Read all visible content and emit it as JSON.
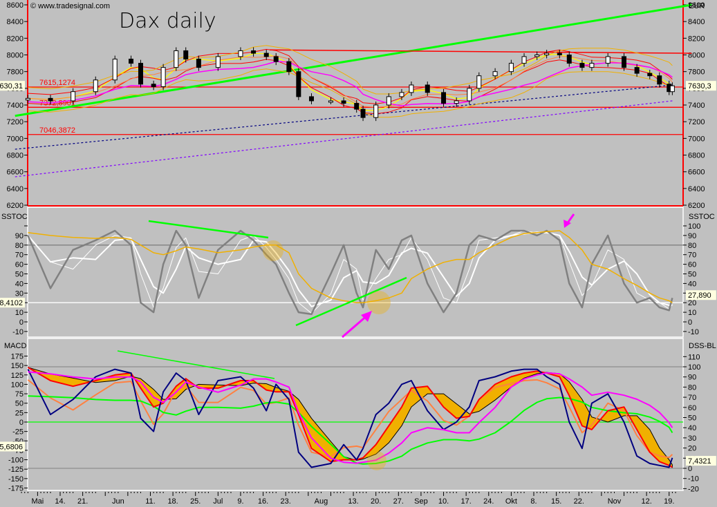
{
  "chart_data": {
    "type": "candlestick-with-indicators",
    "title": "Dax daily",
    "watermark": "© www.tradesignal.com",
    "currency_label": "EUR",
    "grid": false,
    "colors": {
      "background": "#c0c0c0",
      "trend_up": "#00ff00",
      "level": "#ff0000",
      "stoch_fast": "#808080",
      "stoch_slow": "#f0b000",
      "macd": "#000080",
      "macd_signal": "#ff0000",
      "dss": "#ff00ff",
      "arrow": "#ff00ff"
    },
    "x_tick_labels": [
      {
        "date": "2007-05-07",
        "label": "Mai"
      },
      {
        "date": "2007-05-14",
        "label": "14."
      },
      {
        "date": "2007-05-21",
        "label": "21."
      },
      {
        "date": "2007-06-01",
        "label": "Jun"
      },
      {
        "date": "2007-06-11",
        "label": "11."
      },
      {
        "date": "2007-06-18",
        "label": "18."
      },
      {
        "date": "2007-06-25",
        "label": "25."
      },
      {
        "date": "2007-07-02",
        "label": "Jul"
      },
      {
        "date": "2007-07-09",
        "label": "9."
      },
      {
        "date": "2007-07-16",
        "label": "16."
      },
      {
        "date": "2007-07-23",
        "label": "23."
      },
      {
        "date": "2007-08-03",
        "label": "Aug"
      },
      {
        "date": "2007-08-13",
        "label": "13."
      },
      {
        "date": "2007-08-20",
        "label": "20."
      },
      {
        "date": "2007-08-27",
        "label": "27."
      },
      {
        "date": "2007-09-03",
        "label": "Sep"
      },
      {
        "date": "2007-09-10",
        "label": "10."
      },
      {
        "date": "2007-09-17",
        "label": "17."
      },
      {
        "date": "2007-09-24",
        "label": "24."
      },
      {
        "date": "2007-10-01",
        "label": "Okt"
      },
      {
        "date": "2007-10-08",
        "label": "8."
      },
      {
        "date": "2007-10-15",
        "label": "15."
      },
      {
        "date": "2007-10-22",
        "label": "22."
      },
      {
        "date": "2007-11-02",
        "label": "Nov"
      },
      {
        "date": "2007-11-12",
        "label": "12."
      },
      {
        "date": "2007-11-19",
        "label": "19."
      }
    ],
    "dates": [
      "2007-05-04",
      "2007-05-11",
      "2007-05-18",
      "2007-05-25",
      "2007-05-31",
      "2007-06-05",
      "2007-06-08",
      "2007-06-12",
      "2007-06-15",
      "2007-06-19",
      "2007-06-22",
      "2007-06-26",
      "2007-07-02",
      "2007-07-09",
      "2007-07-13",
      "2007-07-17",
      "2007-07-20",
      "2007-07-24",
      "2007-07-27",
      "2007-07-31",
      "2007-08-06",
      "2007-08-10",
      "2007-08-14",
      "2007-08-16",
      "2007-08-20",
      "2007-08-24",
      "2007-08-28",
      "2007-08-31",
      "2007-09-05",
      "2007-09-10",
      "2007-09-14",
      "2007-09-18",
      "2007-09-21",
      "2007-09-26",
      "2007-10-01",
      "2007-10-05",
      "2007-10-09",
      "2007-10-12",
      "2007-10-16",
      "2007-10-19",
      "2007-10-23",
      "2007-10-26",
      "2007-10-31",
      "2007-11-05",
      "2007-11-09",
      "2007-11-13",
      "2007-11-16",
      "2007-11-19",
      "2007-11-20"
    ],
    "price_panel": {
      "ylim": [
        6200,
        8600
      ],
      "y_ticks": [
        6200,
        6400,
        6600,
        6800,
        7000,
        7200,
        7400,
        7600,
        7800,
        8000,
        8200,
        8400,
        8600
      ],
      "close": [
        7480,
        7450,
        7560,
        7700,
        7950,
        7900,
        7650,
        7620,
        7850,
        8050,
        7950,
        7850,
        7980,
        8050,
        8020,
        7980,
        7920,
        7800,
        7500,
        7450,
        7450,
        7420,
        7350,
        7250,
        7400,
        7500,
        7550,
        7640,
        7550,
        7420,
        7450,
        7600,
        7750,
        7800,
        7900,
        7980,
        8000,
        8020,
        8000,
        7900,
        7850,
        7900,
        7980,
        7850,
        7780,
        7750,
        7650,
        7560,
        7630
      ],
      "levels": [
        {
          "value": 7615.1274,
          "label": "7615,1274"
        },
        {
          "value": 7372.8901,
          "label": "7372,8901"
        },
        {
          "value": 7046.3872,
          "label": "7046,3872"
        }
      ],
      "trendline_up": {
        "from": [
          "2007-04-30",
          7270
        ],
        "to": [
          "2007-11-26",
          8600
        ]
      },
      "trendline_resistance": {
        "from": [
          "2007-07-18",
          8060
        ],
        "to": [
          "2007-11-26",
          8020
        ]
      },
      "ma_long_blue": {
        "from": [
          "2007-04-30",
          6870
        ],
        "to": [
          "2007-11-20",
          7640
        ]
      },
      "ma_long_purple": {
        "from": [
          "2007-04-30",
          6540
        ],
        "to": [
          "2007-11-20",
          7450
        ]
      },
      "last_value_left": "630,31",
      "last_value_right": "7630,3",
      "last_value": 7630.31
    },
    "sstoc_panel": {
      "label": "SSTOC",
      "ylim": [
        -10,
        100
      ],
      "y_ticks": [
        -10,
        0,
        10,
        20,
        30,
        40,
        50,
        60,
        70,
        80,
        90,
        100
      ],
      "levels": [
        80,
        20
      ],
      "fast": [
        90,
        35,
        75,
        85,
        95,
        80,
        20,
        10,
        60,
        95,
        80,
        25,
        75,
        95,
        85,
        70,
        60,
        30,
        10,
        8,
        50,
        80,
        30,
        15,
        75,
        55,
        85,
        90,
        40,
        10,
        30,
        80,
        90,
        85,
        95,
        95,
        90,
        95,
        85,
        40,
        15,
        60,
        90,
        40,
        20,
        25,
        15,
        12,
        25
      ],
      "slow": [
        93,
        90,
        88,
        87,
        88,
        86,
        80,
        72,
        70,
        74,
        78,
        76,
        72,
        75,
        78,
        80,
        80,
        72,
        50,
        35,
        25,
        22,
        20,
        20,
        22,
        25,
        30,
        45,
        55,
        62,
        65,
        65,
        72,
        80,
        88,
        92,
        93,
        94,
        95,
        88,
        75,
        60,
        55,
        45,
        38,
        30,
        25,
        22,
        20
      ],
      "last_value_left": "8,4102",
      "last_value_right": "27,890"
    },
    "macd_panel": {
      "label": "MACD",
      "label_right": "DSS-BL",
      "ylim": [
        -175,
        175
      ],
      "y_ticks": [
        -175,
        -150,
        -125,
        -100,
        -75,
        -50,
        -25,
        0,
        25,
        50,
        75,
        100,
        125,
        150,
        175
      ],
      "right_ylim": [
        -20,
        110
      ],
      "right_y_ticks": [
        -20,
        -10,
        0,
        10,
        20,
        30,
        40,
        50,
        60,
        70,
        80,
        90,
        100,
        110
      ],
      "macd": [
        140,
        20,
        60,
        120,
        140,
        130,
        10,
        -25,
        80,
        130,
        110,
        20,
        110,
        120,
        90,
        30,
        100,
        60,
        -80,
        -120,
        -110,
        -60,
        -100,
        -70,
        20,
        50,
        100,
        110,
        30,
        -20,
        0,
        40,
        110,
        120,
        135,
        140,
        140,
        120,
        100,
        0,
        -70,
        50,
        75,
        0,
        -90,
        -110,
        -115,
        -120,
        -95
      ],
      "signal": [
        145,
        110,
        95,
        110,
        125,
        130,
        90,
        40,
        50,
        95,
        115,
        90,
        90,
        110,
        110,
        85,
        80,
        80,
        20,
        -70,
        -105,
        -100,
        -100,
        -95,
        -60,
        -10,
        40,
        90,
        95,
        40,
        10,
        15,
        60,
        100,
        120,
        130,
        135,
        130,
        120,
        70,
        -10,
        -20,
        30,
        40,
        -20,
        -80,
        -105,
        -115,
        -120
      ],
      "dss": [
        95,
        93,
        90,
        88,
        90,
        90,
        85,
        70,
        65,
        75,
        85,
        80,
        75,
        82,
        88,
        88,
        85,
        80,
        55,
        30,
        10,
        6,
        5,
        6,
        8,
        15,
        25,
        35,
        40,
        38,
        35,
        35,
        45,
        60,
        80,
        88,
        92,
        94,
        93,
        88,
        80,
        72,
        75,
        72,
        68,
        62,
        55,
        45,
        40
      ],
      "last_value_left": "5,6806",
      "last_value_right": "7,4321"
    }
  }
}
